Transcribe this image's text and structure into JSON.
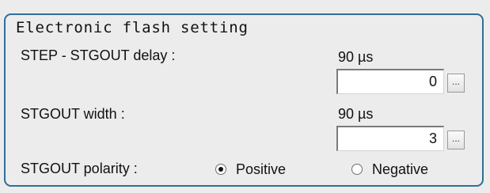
{
  "group": {
    "title": "Electronic flash setting"
  },
  "rows": {
    "delay": {
      "label": "STEP - STGOUT delay :",
      "value_text": "90  µs",
      "input_value": "0",
      "button_label": "..."
    },
    "width": {
      "label": "STGOUT width :",
      "value_text": "90  µs",
      "input_value": "3",
      "button_label": "..."
    },
    "polarity": {
      "label": "STGOUT polarity :",
      "options": [
        {
          "label": "Positive",
          "selected": true
        },
        {
          "label": "Negative",
          "selected": false
        }
      ]
    }
  }
}
